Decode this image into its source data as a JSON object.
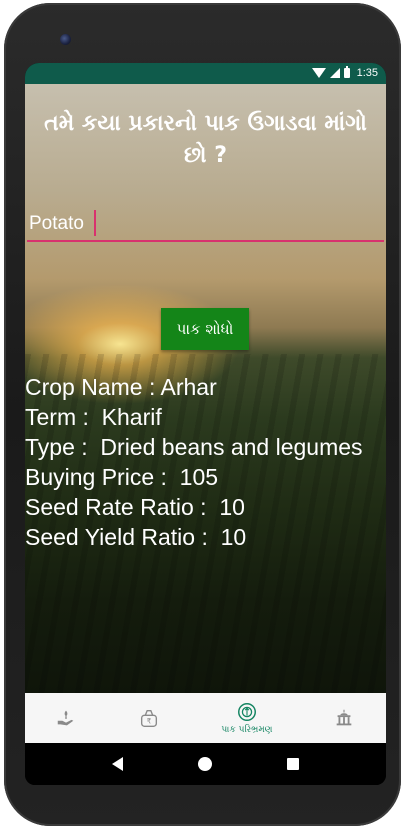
{
  "status_bar": {
    "time": "1:35",
    "icons": [
      "wifi-icon",
      "signal-icon",
      "battery-icon"
    ]
  },
  "header": {
    "title": "તમે કયા પ્રકારનો પાક ઉગાડવા માંગો છો ?"
  },
  "search": {
    "value": "Potato",
    "button_label": "પાક શોધો"
  },
  "result": {
    "crop_name": "Crop Name : Arhar",
    "term": "Term :  Kharif",
    "type": "Type :  Dried beans and legumes",
    "buying_price": "Buying Price :  105",
    "seed_rate_ratio": "Seed Rate Ratio :  10",
    "seed_yield_ratio": "Seed Yield Ratio :  10"
  },
  "bottom_nav": {
    "items": [
      {
        "icon": "hand-plant-icon",
        "label": ""
      },
      {
        "icon": "money-bag-icon",
        "label": ""
      },
      {
        "icon": "crop-rotation-icon",
        "label": "પાક પરિભ્રમણ"
      },
      {
        "icon": "government-building-icon",
        "label": ""
      }
    ]
  },
  "colors": {
    "status_bar": "#0f5b4b",
    "button": "#148518",
    "input_underline": "#d8326e",
    "nav_active": "#148562"
  }
}
